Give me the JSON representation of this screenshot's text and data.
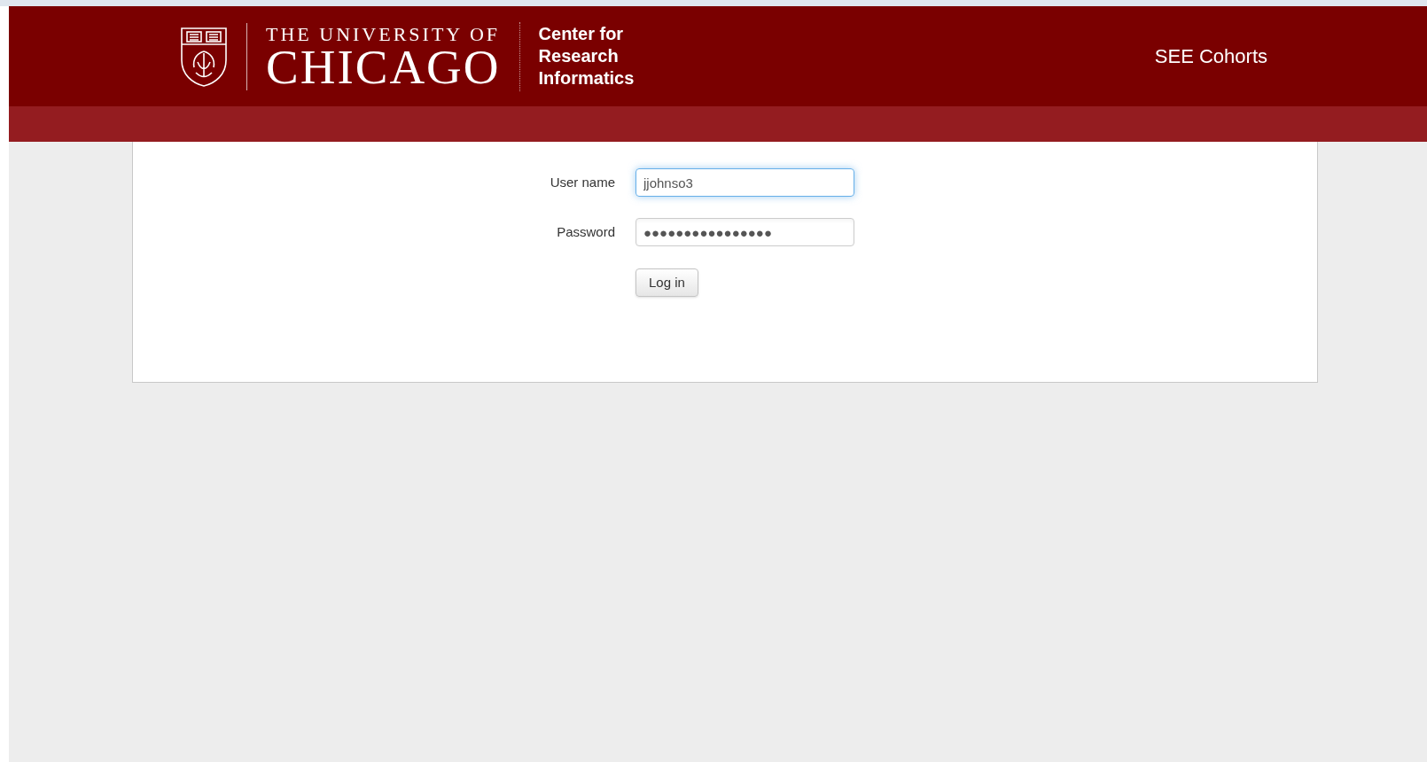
{
  "header": {
    "university_line1": "THE UNIVERSITY OF",
    "university_line2": "CHICAGO",
    "center_name": [
      "Center for",
      "Research",
      "Informatics"
    ],
    "app_title": "SEE Cohorts"
  },
  "login_form": {
    "fields": [
      {
        "label": "User name",
        "value": "jjohnso3",
        "focused": true
      },
      {
        "label": "Password",
        "value": "●●●●●●●●●●●●●●●●",
        "focused": false
      }
    ],
    "submit_button": "Log in"
  }
}
